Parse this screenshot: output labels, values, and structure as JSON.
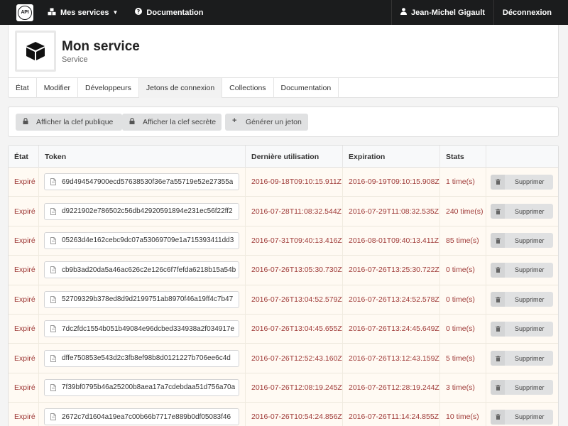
{
  "navbar": {
    "logo_text": "API",
    "services_label": "Mes services",
    "docs_label": "Documentation",
    "user_name": "Jean-Michel Gigault",
    "logout_label": "Déconnexion"
  },
  "service": {
    "title": "Mon service",
    "subtitle": "Service"
  },
  "tabs": [
    {
      "label": "État"
    },
    {
      "label": "Modifier"
    },
    {
      "label": "Développeurs"
    },
    {
      "label": "Jetons de connexion",
      "active": true
    },
    {
      "label": "Collections"
    },
    {
      "label": "Documentation"
    }
  ],
  "actions": {
    "public_key": "Afficher la clef publique",
    "secret_key": "Afficher la clef secrète",
    "generate": "Générer un jeton"
  },
  "table": {
    "headers": {
      "state": "État",
      "token": "Token",
      "last_use": "Dernière utilisation",
      "expiration": "Expiration",
      "stats": "Stats"
    },
    "delete_label": "Supprimer",
    "rows": [
      {
        "state": "Expiré",
        "token": "69d494547900ecd57638530f36e7a55719e52e27355a",
        "last_use": "2016-09-18T09:10:15.911Z",
        "expiration": "2016-09-19T09:10:15.908Z",
        "stats": "1 time(s)"
      },
      {
        "state": "Expiré",
        "token": "d9221902e786502c56db42920591894e231ec56f22ff2",
        "last_use": "2016-07-28T11:08:32.544Z",
        "expiration": "2016-07-29T11:08:32.535Z",
        "stats": "240 time(s)"
      },
      {
        "state": "Expiré",
        "token": "05263d4e162cebc9dc07a53069709e1a715393411dd3",
        "last_use": "2016-07-31T09:40:13.416Z",
        "expiration": "2016-08-01T09:40:13.411Z",
        "stats": "85 time(s)"
      },
      {
        "state": "Expiré",
        "token": "cb9b3ad20da5a46ac626c2e126c6f7fefda6218b15a54b",
        "last_use": "2016-07-26T13:05:30.730Z",
        "expiration": "2016-07-26T13:25:30.722Z",
        "stats": "0 time(s)"
      },
      {
        "state": "Expiré",
        "token": "52709329b378ed8d9d2199751ab8970f46a19ff4c7b47",
        "last_use": "2016-07-26T13:04:52.579Z",
        "expiration": "2016-07-26T13:24:52.578Z",
        "stats": "0 time(s)"
      },
      {
        "state": "Expiré",
        "token": "7dc2fdc1554b051b49084e96dcbed334938a2f034917e",
        "last_use": "2016-07-26T13:04:45.655Z",
        "expiration": "2016-07-26T13:24:45.649Z",
        "stats": "0 time(s)"
      },
      {
        "state": "Expiré",
        "token": "dffe750853e543d2c3fb8ef98b8d0121227b706ee6c4d",
        "last_use": "2016-07-26T12:52:43.160Z",
        "expiration": "2016-07-26T13:12:43.159Z",
        "stats": "5 time(s)"
      },
      {
        "state": "Expiré",
        "token": "7f39bf0795b46a25200b8aea17a7cdebdaa51d756a70a",
        "last_use": "2016-07-26T12:08:19.245Z",
        "expiration": "2016-07-26T12:28:19.244Z",
        "stats": "3 time(s)"
      },
      {
        "state": "Expiré",
        "token": "2672c7d1604a19ea7c00b66b7717e889b0df05083f46",
        "last_use": "2016-07-26T10:54:24.856Z",
        "expiration": "2016-07-26T11:14:24.855Z",
        "stats": "10 time(s)"
      }
    ]
  }
}
